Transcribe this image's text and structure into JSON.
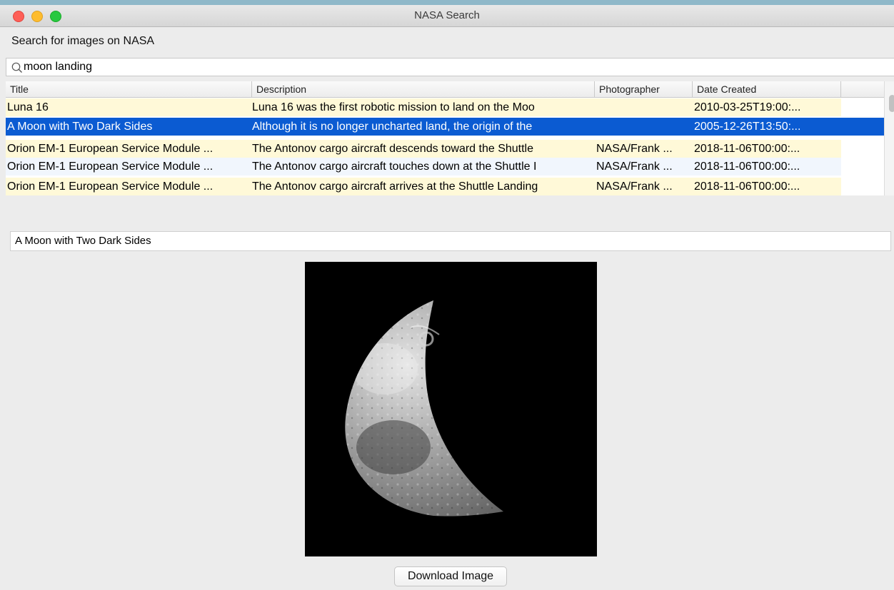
{
  "window": {
    "title": "NASA Search"
  },
  "heading": "Search for images on NASA",
  "search": {
    "value": "moon landing"
  },
  "table": {
    "columns": [
      "Title",
      "Description",
      "Photographer",
      "Date Created"
    ],
    "rows": [
      {
        "title": "Luna 16",
        "description": "Luna 16 was the first robotic mission to land on the Moo",
        "photographer": "",
        "date": "2010-03-25T19:00:..."
      },
      {
        "title": "A Moon with Two Dark Sides",
        "description": "Although it is no longer uncharted land, the origin of the",
        "photographer": "",
        "date": "2005-12-26T13:50:..."
      },
      {
        "title": "Orion EM-1 European Service Module ...",
        "description": "The Antonov cargo aircraft descends toward the Shuttle",
        "photographer": "NASA/Frank ...",
        "date": "2018-11-06T00:00:..."
      },
      {
        "title": "Orion EM-1 European Service Module ...",
        "description": "The Antonov cargo aircraft touches down at the Shuttle I",
        "photographer": "NASA/Frank ...",
        "date": "2018-11-06T00:00:..."
      },
      {
        "title": "Orion EM-1 European Service Module ...",
        "description": "The Antonov cargo aircraft arrives at the Shuttle Landing",
        "photographer": "NASA/Frank ...",
        "date": "2018-11-06T00:00:..."
      }
    ],
    "selected_index": 1
  },
  "detail": {
    "title": "A Moon with Two Dark Sides"
  },
  "download_label": "Download Image",
  "colors": {
    "selection": "#0b5bd2",
    "row_odd": "#fff9d8",
    "row_even": "#f1f6fd",
    "close": "#fe5f57",
    "minimize": "#febc2e",
    "maximize": "#28c840"
  }
}
